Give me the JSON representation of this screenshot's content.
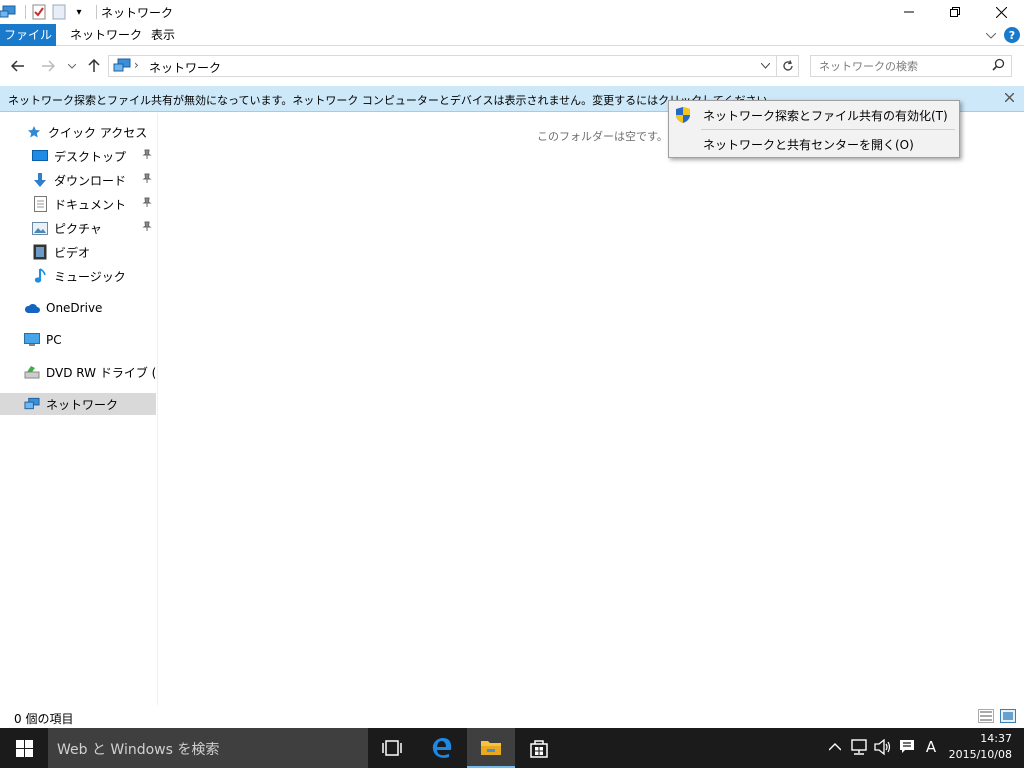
{
  "window": {
    "title": "ネットワーク",
    "qat_dropdown_glyph": "▾"
  },
  "ribbon": {
    "tabs": [
      {
        "label": "ファイル"
      },
      {
        "label": "ネットワーク"
      },
      {
        "label": "表示"
      }
    ],
    "help": "?"
  },
  "address": {
    "separator": "›",
    "location": "ネットワーク"
  },
  "search": {
    "placeholder": "ネットワークの検索"
  },
  "infobar": {
    "text": "ネットワーク探索とファイル共有が無効になっています。ネットワーク コンピューターとデバイスは表示されません。変更するにはクリックしてください..."
  },
  "navpane": {
    "quick_access": "クイック アクセス",
    "items": [
      {
        "label": "デスクトップ",
        "icon": "desktop-icon"
      },
      {
        "label": "ダウンロード",
        "icon": "download-icon"
      },
      {
        "label": "ドキュメント",
        "icon": "document-icon"
      },
      {
        "label": "ピクチャ",
        "icon": "picture-icon"
      },
      {
        "label": "ビデオ",
        "icon": "video-icon"
      },
      {
        "label": "ミュージック",
        "icon": "music-icon"
      }
    ],
    "onedrive": "OneDrive",
    "pc": "PC",
    "dvd": "DVD RW ドライブ (D:) E",
    "network": "ネットワーク"
  },
  "content": {
    "empty_message": "このフォルダーは空です。"
  },
  "context_menu": {
    "items": [
      {
        "label": "ネットワーク探索とファイル共有の有効化(T)"
      },
      {
        "label": "ネットワークと共有センターを開く(O)"
      }
    ]
  },
  "statusbar": {
    "item_count": "0 個の項目"
  },
  "taskbar": {
    "search_placeholder": "Web と Windows を検索",
    "ime": "A",
    "time": "14:37",
    "date": "2015/10/08"
  },
  "colors": {
    "accent": "#1979ca",
    "infobar": "#cde8f8",
    "taskbar": "#1b1b1b"
  }
}
